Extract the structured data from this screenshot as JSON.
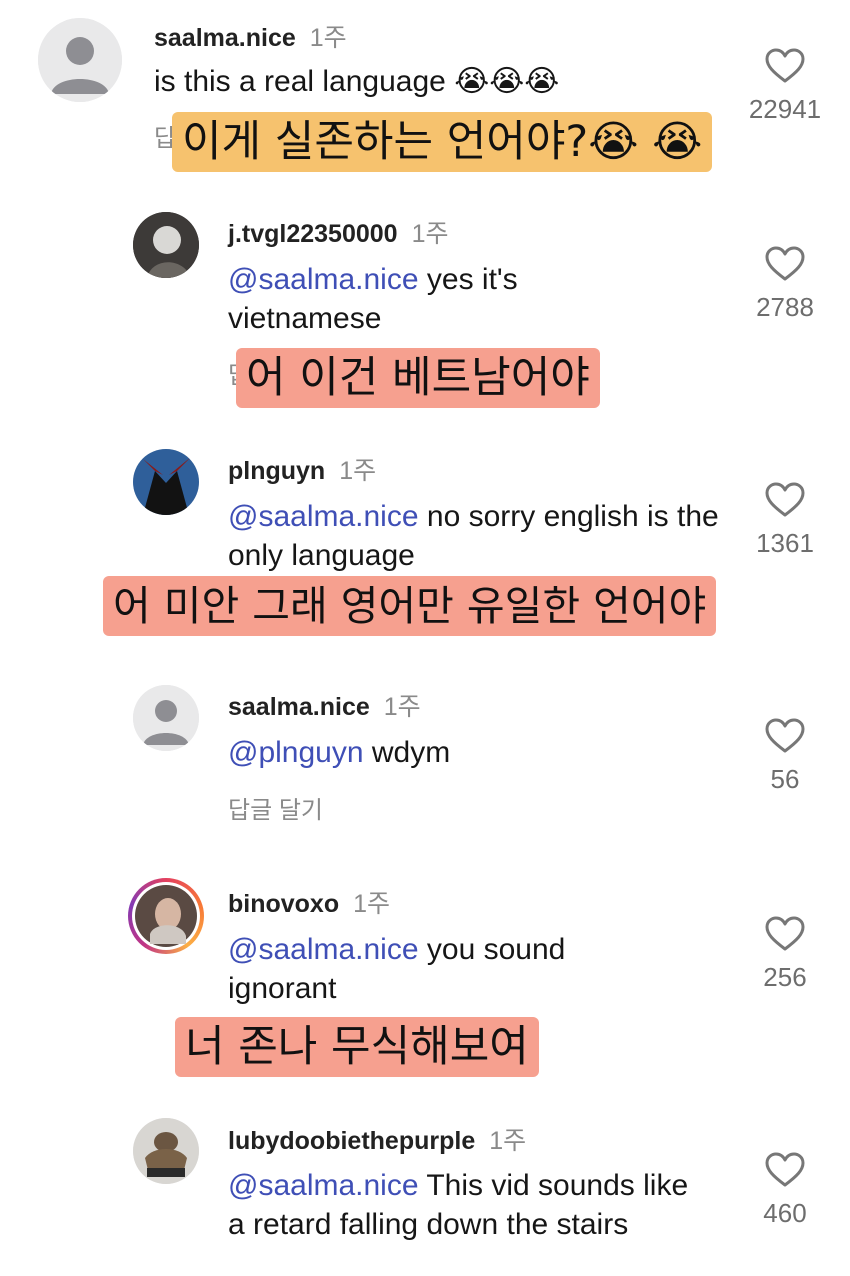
{
  "comments": [
    {
      "username": "saalma.nice",
      "time": "1주",
      "mention": "",
      "text": "is this a real language 😭😭😭",
      "reply": "답글 달기",
      "likes": "22941",
      "subtitle": "이게 실존하는 언어야?😭 😭"
    },
    {
      "username": "j.tvgl22350000",
      "time": "1주",
      "mention": "@saalma.nice",
      "text": " yes it's vietnamese",
      "reply": "답",
      "likes": "2788",
      "subtitle": "어 이건 베트남어야"
    },
    {
      "username": "plnguyn",
      "time": "1주",
      "mention": "@saalma.nice",
      "text": " no sorry english is the only language",
      "likes": "1361",
      "subtitle": "어 미안 그래 영어만 유일한 언어야"
    },
    {
      "username": "saalma.nice",
      "time": "1주",
      "mention": "@plnguyn",
      "text": " wdym",
      "reply": "답글 달기",
      "likes": "56"
    },
    {
      "username": "binovoxo",
      "time": "1주",
      "mention": "@saalma.nice",
      "text": " you sound ignorant",
      "likes": "256",
      "subtitle": "너 존나 무식해보여"
    },
    {
      "username": "lubydoobiethepurple",
      "time": "1주",
      "mention": "@saalma.nice",
      "text": " This vid sounds like a retard falling down the stairs",
      "likes": "460"
    }
  ],
  "colors": {
    "mention": "#3f4fb6",
    "subtitle_yellow": "#f6c26e",
    "subtitle_salmon": "#f6a08f"
  },
  "icons": {
    "like": "heart-outline-icon",
    "default_avatar": "person-icon"
  }
}
